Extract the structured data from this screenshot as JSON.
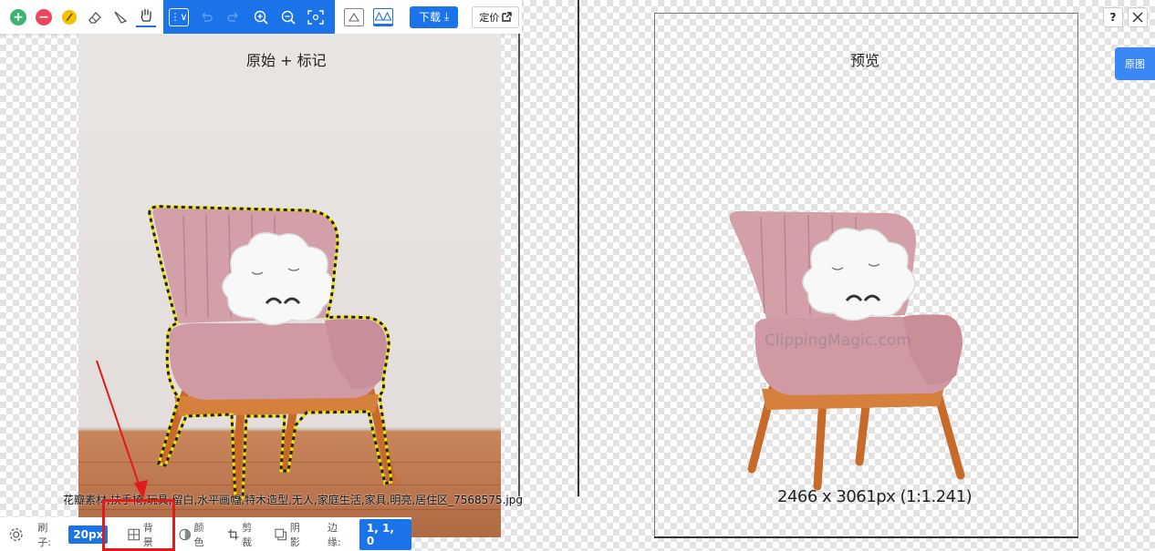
{
  "toolbar": {
    "download_label": "下载",
    "price_label": "定价"
  },
  "left_panel": {
    "title": "原始 + 标记",
    "filename": "花瓣素材,扶手椅,玩具,留白,水平画幅,特木造型,无人,家庭生活,家具,明亮,居住区_7568575.jpg"
  },
  "right_panel": {
    "title": "预览",
    "dimensions": "2466 x 3061px (1:1.241)",
    "watermark": "ClippingMagic.com",
    "help_label": "?",
    "original_label": "原图"
  },
  "bottom_bar": {
    "brush_label": "刷子:",
    "brush_value": "20px",
    "background_label": "背景",
    "color_label": "颜色",
    "crop_label": "剪裁",
    "shadow_label": "阴影",
    "edge_label": "边缘:",
    "edge_value": "1, 1, 0"
  },
  "colors": {
    "accent": "#1a73e8",
    "highlight": "#e01b1b",
    "add_green": "#3cb371",
    "remove_red": "#e8475f",
    "marker_yellow": "#f2c200"
  }
}
